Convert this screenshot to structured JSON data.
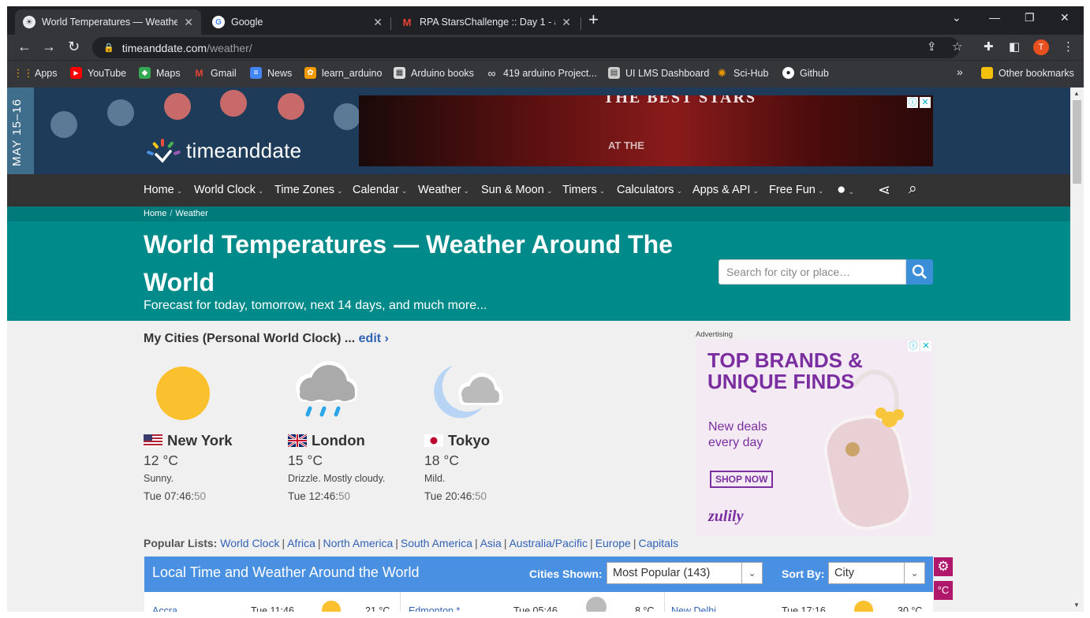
{
  "browser": {
    "tabs": [
      {
        "title": "World Temperatures — Weather",
        "active": true
      },
      {
        "title": "Google",
        "active": false
      },
      {
        "title": "RPA StarsChallenge :: Day 1 - ada",
        "active": false
      }
    ],
    "url_host": "timeanddate.com",
    "url_path": "/weather/",
    "avatar_letter": "T",
    "bookmarks": [
      {
        "label": "Apps",
        "icon": "apps-grid-icon"
      },
      {
        "label": "YouTube",
        "icon": "youtube-icon"
      },
      {
        "label": "Maps",
        "icon": "maps-icon"
      },
      {
        "label": "Gmail",
        "icon": "gmail-icon"
      },
      {
        "label": "News",
        "icon": "news-icon"
      },
      {
        "label": "learn_arduino",
        "icon": "arduino-icon"
      },
      {
        "label": "Arduino books",
        "icon": "book-icon"
      },
      {
        "label": "419 arduino Project...",
        "icon": "infinity-icon"
      },
      {
        "label": "UI LMS Dashboard",
        "icon": "lms-icon"
      },
      {
        "label": "Sci-Hub",
        "icon": "scihub-icon"
      },
      {
        "label": "Github",
        "icon": "github-icon"
      }
    ],
    "overflow": "»",
    "other_bookmarks": "Other bookmarks"
  },
  "site": {
    "date_strip": "MAY 15–16",
    "logo": "timeanddate",
    "top_ad": {
      "line1": "THE BEST STARS",
      "line2": "AT THE"
    },
    "nav": [
      "Home",
      "World Clock",
      "Time Zones",
      "Calendar",
      "Weather",
      "Sun & Moon",
      "Timers",
      "Calculators",
      "Apps & API",
      "Free Fun"
    ],
    "breadcrumb": [
      "Home",
      "Weather"
    ],
    "title": "World Temperatures — Weather Around The World",
    "subtitle": "Forecast for today, tomorrow, next 14 days, and much more...",
    "search_placeholder": "Search for city or place…"
  },
  "my_cities": {
    "heading": "My Cities (Personal World Clock) ... ",
    "edit": "edit ›",
    "cities": [
      {
        "name": "New York",
        "temp": "12 °C",
        "desc": "Sunny.",
        "time": "Tue 07:46:",
        "sec": "50",
        "weather_icon": "sun-icon",
        "flag": "us-flag-icon"
      },
      {
        "name": "London",
        "temp": "15 °C",
        "desc": "Drizzle. Mostly cloudy.",
        "time": "Tue 12:46:",
        "sec": "50",
        "weather_icon": "rain-cloud-icon",
        "flag": "uk-flag-icon"
      },
      {
        "name": "Tokyo",
        "temp": "18 °C",
        "desc": "Mild.",
        "time": "Tue 20:46:",
        "sec": "50",
        "weather_icon": "moon-cloud-icon",
        "flag": "japan-flag-icon"
      }
    ]
  },
  "side_ad": {
    "label": "Advertising",
    "headline": "TOP BRANDS & UNIQUE FINDS",
    "text": "New deals every day",
    "cta": "SHOP NOW",
    "brand": "zulily"
  },
  "popular_lists": {
    "label": "Popular Lists:",
    "links": [
      "World Clock",
      "Africa",
      "North America",
      "South America",
      "Asia",
      "Australia/Pacific",
      "Europe",
      "Capitals"
    ]
  },
  "local_time": {
    "title": "Local Time and Weather Around the World",
    "cities_shown_label": "Cities Shown:",
    "cities_shown_value": "Most Popular (143)",
    "sort_by_label": "Sort By:",
    "sort_by_value": "City",
    "unit": "°C",
    "row_cells": [
      "Accra",
      "Tue 11:46",
      "21 °C",
      "Edmonton *",
      "Tue 05:46",
      "8 °C",
      "New Delhi",
      "Tue 17:16",
      "30 °C"
    ]
  },
  "colors": {
    "header_bg": "#1e3c59",
    "hero_bg": "#008a8a",
    "link": "#3262b4",
    "table_bar": "#4a90e2",
    "settings": "#b0186c"
  }
}
